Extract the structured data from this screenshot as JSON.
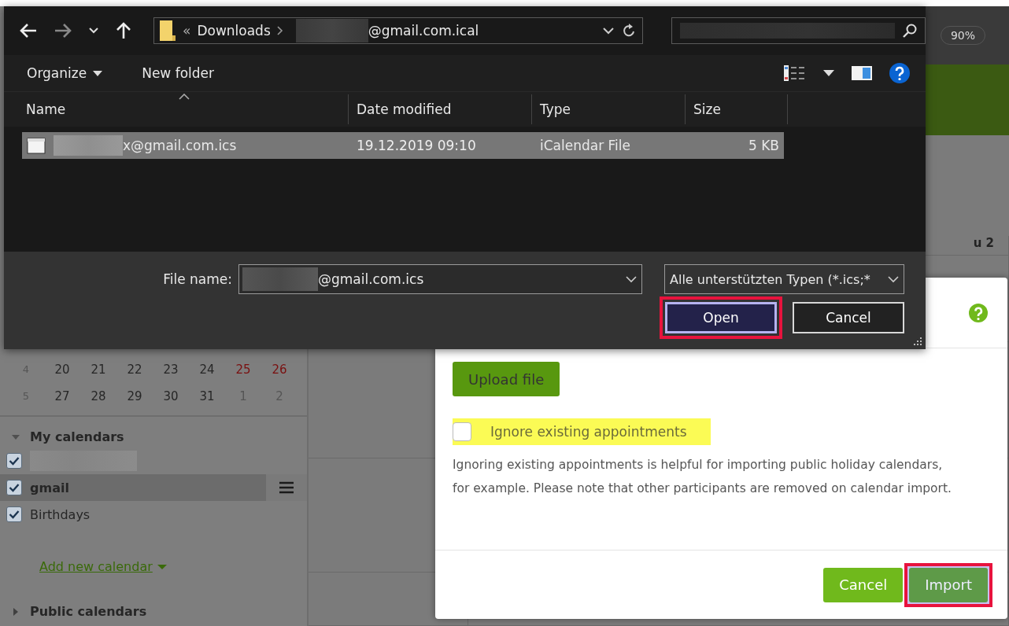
{
  "background": {
    "zoom": "90%",
    "column_header": "u 2",
    "mini_calendar": [
      {
        "week": "4",
        "days": [
          {
            "text": "20",
            "kind": "weekday"
          },
          {
            "text": "21",
            "kind": "weekday"
          },
          {
            "text": "22",
            "kind": "weekday"
          },
          {
            "text": "23",
            "kind": "weekday"
          },
          {
            "text": "24",
            "kind": "weekday"
          },
          {
            "text": "25",
            "kind": "weekend"
          },
          {
            "text": "26",
            "kind": "weekend"
          }
        ]
      },
      {
        "week": "5",
        "days": [
          {
            "text": "27",
            "kind": "weekday"
          },
          {
            "text": "28",
            "kind": "weekday"
          },
          {
            "text": "29",
            "kind": "weekday"
          },
          {
            "text": "30",
            "kind": "weekday"
          },
          {
            "text": "31",
            "kind": "weekday"
          },
          {
            "text": "1",
            "kind": "other"
          },
          {
            "text": "2",
            "kind": "other"
          }
        ]
      }
    ],
    "my_calendars": {
      "title": "My calendars",
      "expanded": true,
      "items": [
        {
          "kind": "redacted",
          "checked": true,
          "selected": false
        },
        {
          "kind": "calendar",
          "label": "gmail",
          "checked": true,
          "selected": true
        },
        {
          "kind": "calendar",
          "label": "Birthdays",
          "checked": true,
          "selected": false
        }
      ],
      "add_link": "Add new calendar"
    },
    "public_calendars": {
      "title": "Public calendars",
      "expanded": false
    }
  },
  "file_dialog": {
    "address": {
      "overflow": "«",
      "folder": "Downloads",
      "tail": "@gmail.com.ical"
    },
    "toolbar": {
      "organize": "Organize",
      "new_folder": "New folder"
    },
    "columns": [
      "Name",
      "Date modified",
      "Type",
      "Size"
    ],
    "rows": [
      {
        "name": "x@gmail.com.ics",
        "date": "19.12.2019 09:10",
        "type": "iCalendar File",
        "size": "5 KB",
        "selected": true
      }
    ],
    "file_name_label": "File name:",
    "file_name_value": "@gmail.com.ics",
    "file_type": "Alle unterstützten Typen (*.ics;*",
    "buttons": [
      {
        "label": "Open",
        "kind": "primary",
        "highlighted": true
      },
      {
        "label": "Cancel",
        "kind": "secondary",
        "highlighted": false
      }
    ]
  },
  "import_modal": {
    "upload_button": "Upload file",
    "ignore_option": {
      "label": "Ignore existing appointments",
      "checked": false,
      "highlighted": true
    },
    "description": "Ignoring existing appointments is helpful for importing public holiday calendars, for example. Please note that other participants are removed on calendar import.",
    "buttons": [
      {
        "label": "Cancel",
        "kind": "secondary",
        "highlighted": false
      },
      {
        "label": "Import",
        "kind": "primary",
        "highlighted": true
      }
    ]
  }
}
